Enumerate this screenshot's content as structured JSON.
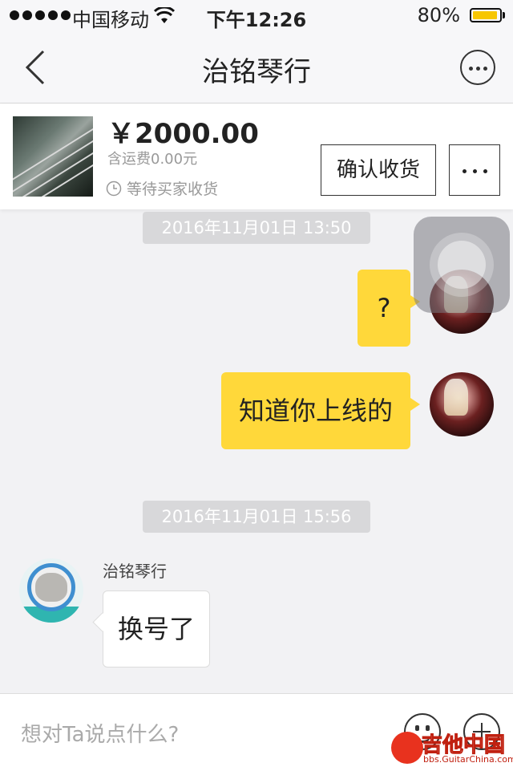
{
  "status_bar": {
    "carrier": "中国移动",
    "time": "下午12:26",
    "battery": "80%",
    "battery_level": 0.8,
    "battery_color": "#f7c600"
  },
  "nav": {
    "back_icon": "chevron-left-icon",
    "title": "治铭琴行",
    "more_icon": "more-horizontal-icon"
  },
  "product": {
    "price": "￥2000.00",
    "shipping": "含运费0.00元",
    "status": "等待买家收货",
    "status_icon": "clock-icon",
    "confirm_label": "确认收货",
    "more_icon": "more-horizontal-icon"
  },
  "chat": {
    "messages": [
      {
        "type": "timestamp",
        "text": "2016年11月01日 13:50"
      },
      {
        "type": "outgoing",
        "text": "?"
      },
      {
        "type": "outgoing",
        "text": "知道你上线的"
      },
      {
        "type": "timestamp",
        "text": "2016年11月01日 15:56"
      },
      {
        "type": "incoming",
        "sender": "治铭琴行",
        "text": "换号了"
      }
    ],
    "outgoing_bubble_color": "#ffd83a"
  },
  "input": {
    "placeholder": "想对Ta说点什么?",
    "emoji_icon": "smiley-icon",
    "plus_icon": "plus-circle-icon"
  },
  "watermark": {
    "text": "吉他中国",
    "sub": "bbs.GuitarChina.com"
  }
}
